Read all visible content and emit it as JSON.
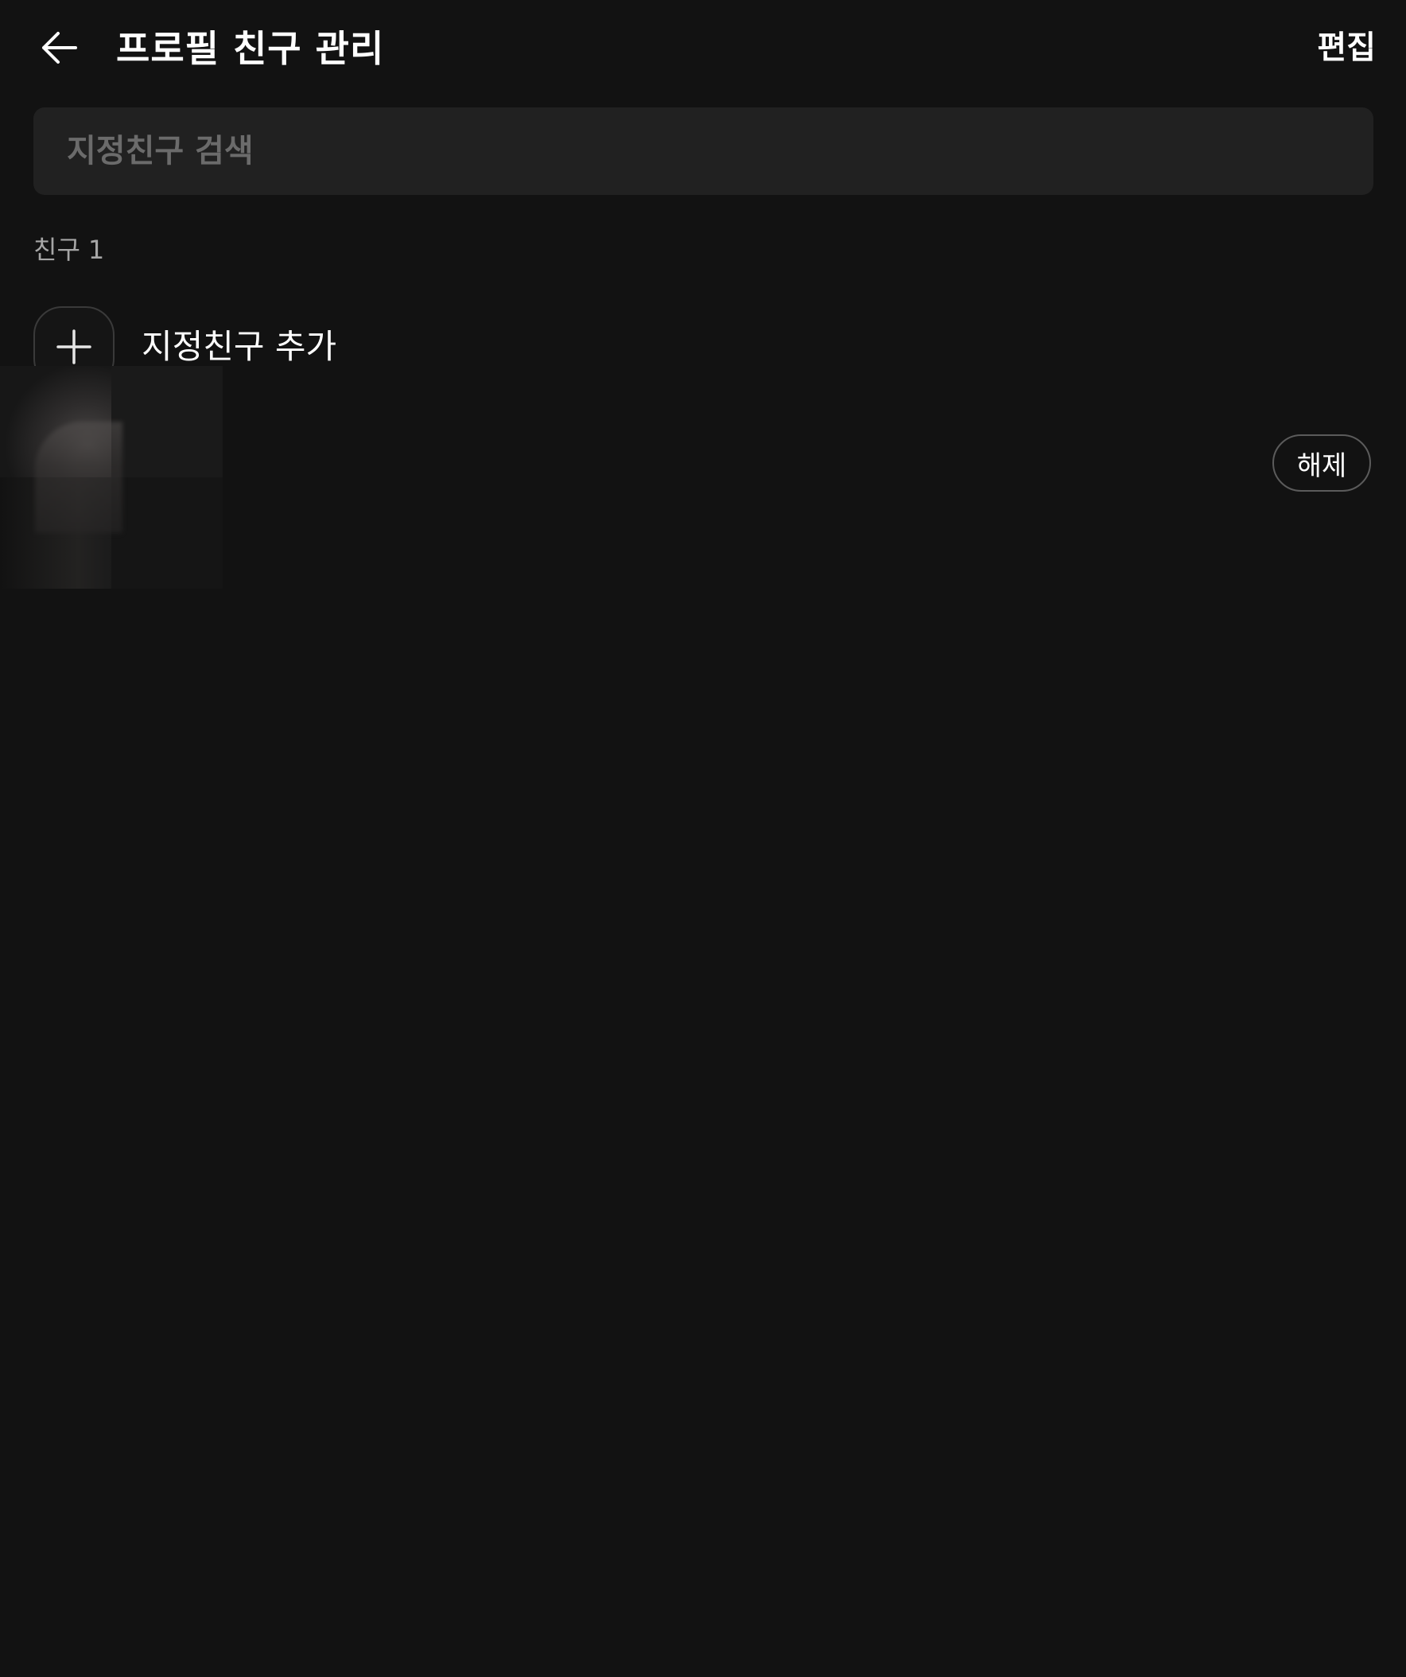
{
  "header": {
    "back_icon": "arrow-left-icon",
    "title": "프로필 친구 관리",
    "edit_label": "편집"
  },
  "search": {
    "placeholder": "지정친구 검색",
    "value": ""
  },
  "friends_section": {
    "label": "친구",
    "count": "1"
  },
  "add_friend": {
    "icon": "plus-icon",
    "label": "지정친구 추가"
  },
  "friends": [
    {
      "avatar": "blurred-profile-image",
      "action_label": "해제"
    }
  ],
  "colors": {
    "background": "#121212",
    "search_background": "#212121",
    "placeholder_text": "#6b6b6b",
    "secondary_text": "#a6a6a6",
    "primary_text": "#ffffff",
    "border": "#5b5b5b"
  }
}
